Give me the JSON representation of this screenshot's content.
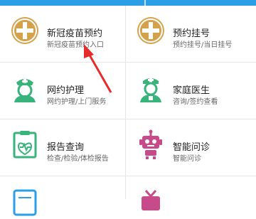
{
  "colors": {
    "accent": "#2a9ee6",
    "gold": "#d6a14b",
    "green": "#37b37b",
    "pink": "#c74a8a",
    "arrow": "#e52b2b"
  },
  "items": [
    {
      "title": "新冠疫苗预约",
      "subtitle": "新冠疫苗预约入口",
      "icon": "plus-circle-icon"
    },
    {
      "title": "预约挂号",
      "subtitle": "预约挂号/当日挂号",
      "icon": "plus-circle-icon"
    },
    {
      "title": "网约护理",
      "subtitle": "网约护理/上门服务",
      "icon": "nurse-icon"
    },
    {
      "title": "家庭医生",
      "subtitle": "咨询/签约查看",
      "icon": "doctor-icon"
    },
    {
      "title": "报告查询",
      "subtitle": "检查/检验/体检报告",
      "icon": "report-icon"
    },
    {
      "title": "智能问诊",
      "subtitle": "智能问诊",
      "icon": "robot-icon"
    }
  ]
}
